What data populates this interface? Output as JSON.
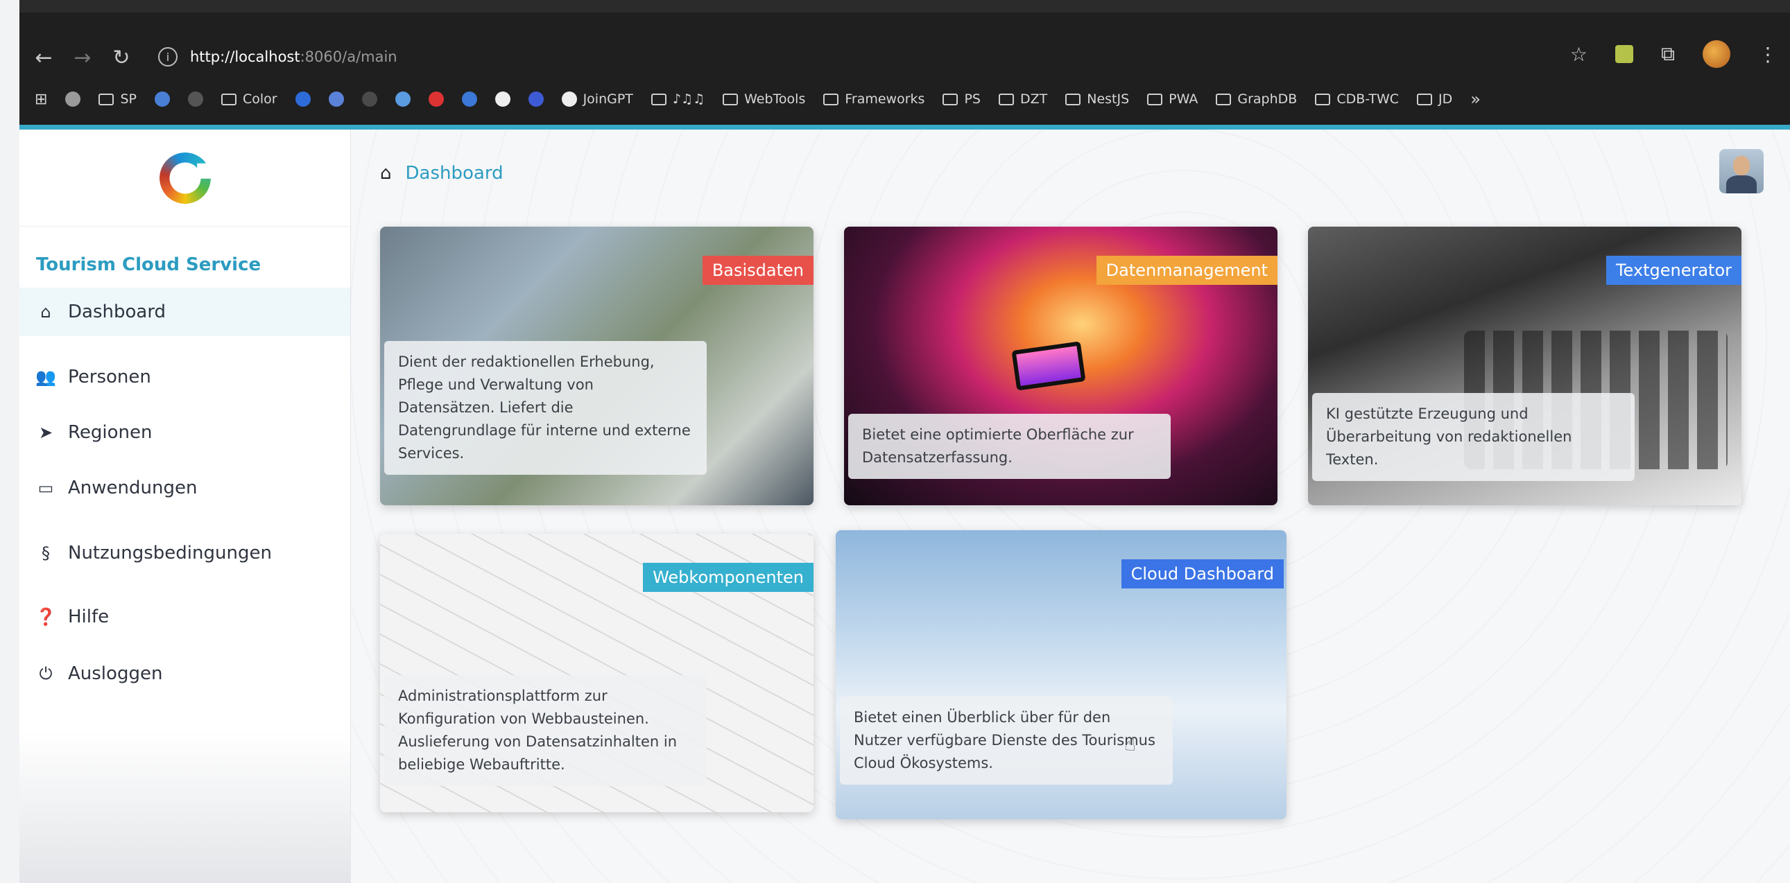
{
  "browser": {
    "url_host": "http://localhost",
    "url_rest": ":8060/a/main",
    "bookmarks": [
      "SP",
      "Color",
      "JoinGPT",
      "♪♫♫",
      "WebTools",
      "Frameworks",
      "PS",
      "DZT",
      "NestJS",
      "PWA",
      "GraphDB",
      "CDB-TWC",
      "JD"
    ],
    "overflow": "»"
  },
  "sidebar": {
    "service_title": "Tourism Cloud Service",
    "items": [
      {
        "label": "Dashboard",
        "icon": "home-icon"
      },
      {
        "label": "Personen",
        "icon": "users-icon"
      },
      {
        "label": "Regionen",
        "icon": "location-arrow-icon"
      },
      {
        "label": "Anwendungen",
        "icon": "laptop-icon"
      },
      {
        "label": "Nutzungsbedingungen",
        "icon": "paragraph-icon"
      },
      {
        "label": "Hilfe",
        "icon": "question-circle-icon"
      },
      {
        "label": "Ausloggen",
        "icon": "power-icon"
      }
    ]
  },
  "header": {
    "breadcrumb": "Dashboard"
  },
  "cards": [
    {
      "badge": "Basisdaten",
      "color": "#e8514a",
      "text": "Dient der redaktionellen Erhebung, Pflege und Verwaltung von Datensätzen. Liefert die Datengrundlage für interne und externe Services."
    },
    {
      "badge": "Datenmanagement",
      "color": "#f3a43b",
      "text": "Bietet eine optimierte Oberfläche zur Datensatzerfassung."
    },
    {
      "badge": "Textgenerator",
      "color": "#3d7fe8",
      "text": "KI gestützte Erzeugung und Überarbeitung von redaktionellen Texten."
    },
    {
      "badge": "Webkomponenten",
      "color": "#35b0cf",
      "text": "Administrationsplattform zur Konfiguration von Webbausteinen. Auslieferung von Datensatzinhalten in beliebige Webauftritte."
    },
    {
      "badge": "Cloud Dashboard",
      "color": "#3b74e6",
      "text": "Bietet einen Überblick über für den Nutzer verfügbare Dienste des Tourismus Cloud Ökosystems."
    }
  ]
}
